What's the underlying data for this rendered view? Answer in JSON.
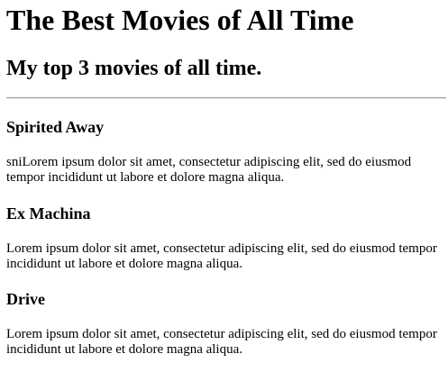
{
  "header": {
    "title": "The Best Movies of All Time",
    "subtitle": "My top 3 movies of all time."
  },
  "movies": [
    {
      "title": "Spirited Away",
      "description": "sniLorem ipsum dolor sit amet, consectetur adipiscing elit, sed do eiusmod tempor incididunt ut labore et dolore magna aliqua."
    },
    {
      "title": "Ex Machina",
      "description": "Lorem ipsum dolor sit amet, consectetur adipiscing elit, sed do eiusmod tempor incididunt ut labore et dolore magna aliqua."
    },
    {
      "title": "Drive",
      "description": "Lorem ipsum dolor sit amet, consectetur adipiscing elit, sed do eiusmod tempor incididunt ut labore et dolore magna aliqua."
    }
  ]
}
